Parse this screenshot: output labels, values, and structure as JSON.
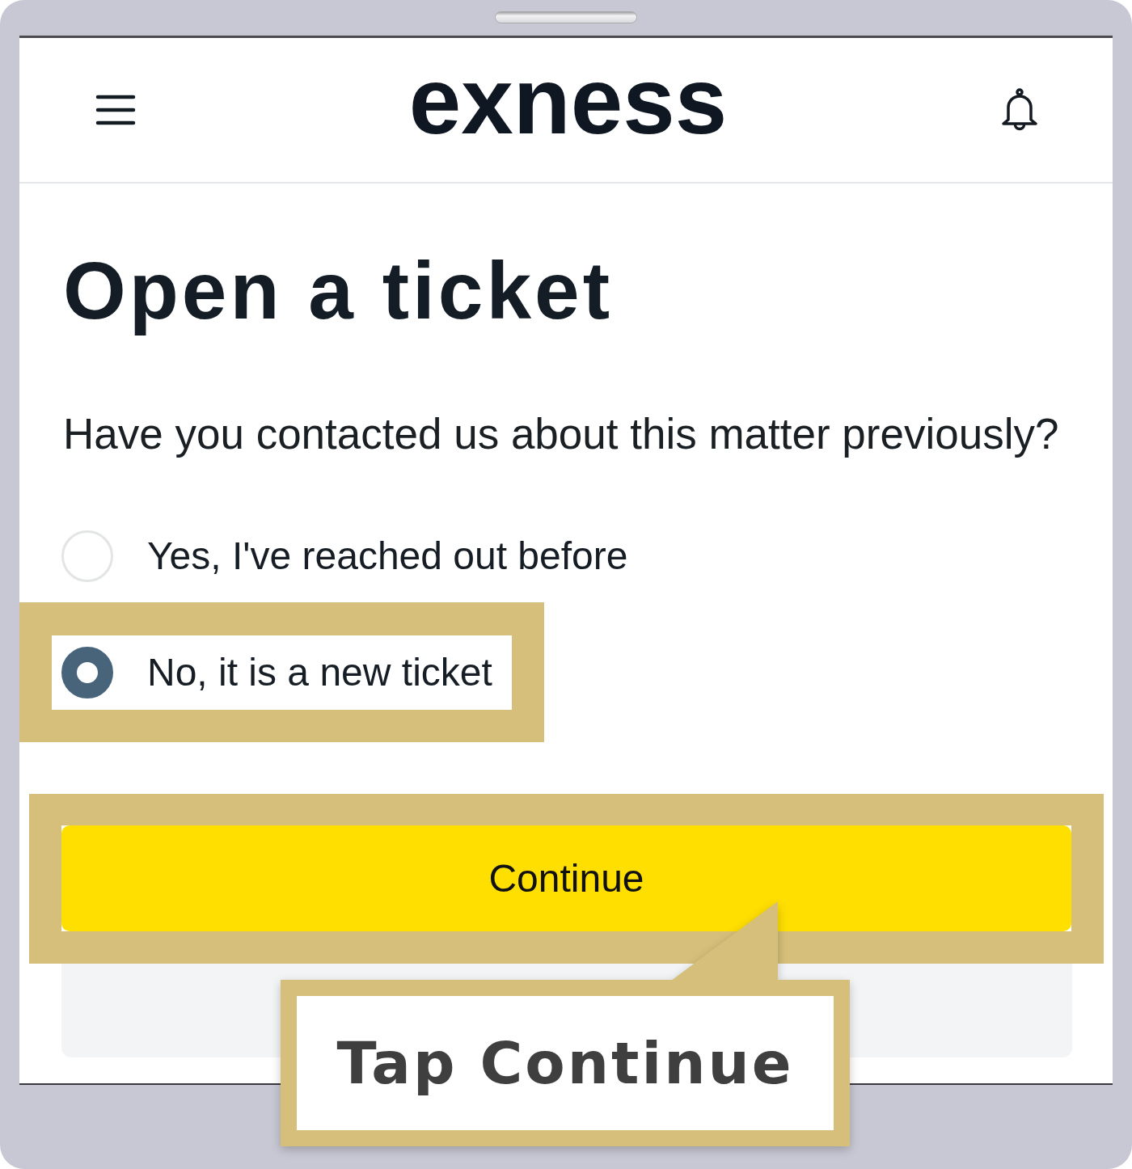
{
  "header": {
    "logo": "exness"
  },
  "title": "Open a ticket",
  "question": "Have you contacted us about this matter previously?",
  "options": [
    {
      "label": "Yes, I've reached out before",
      "selected": false,
      "highlighted": false
    },
    {
      "label": "No, it is a new ticket",
      "selected": true,
      "highlighted": true
    }
  ],
  "buttons": [
    {
      "kind": "primary",
      "label": "Continue",
      "highlighted": true
    },
    {
      "kind": "secondary",
      "highlighted": false
    }
  ],
  "callout": {
    "text": "Tap Continue"
  }
}
